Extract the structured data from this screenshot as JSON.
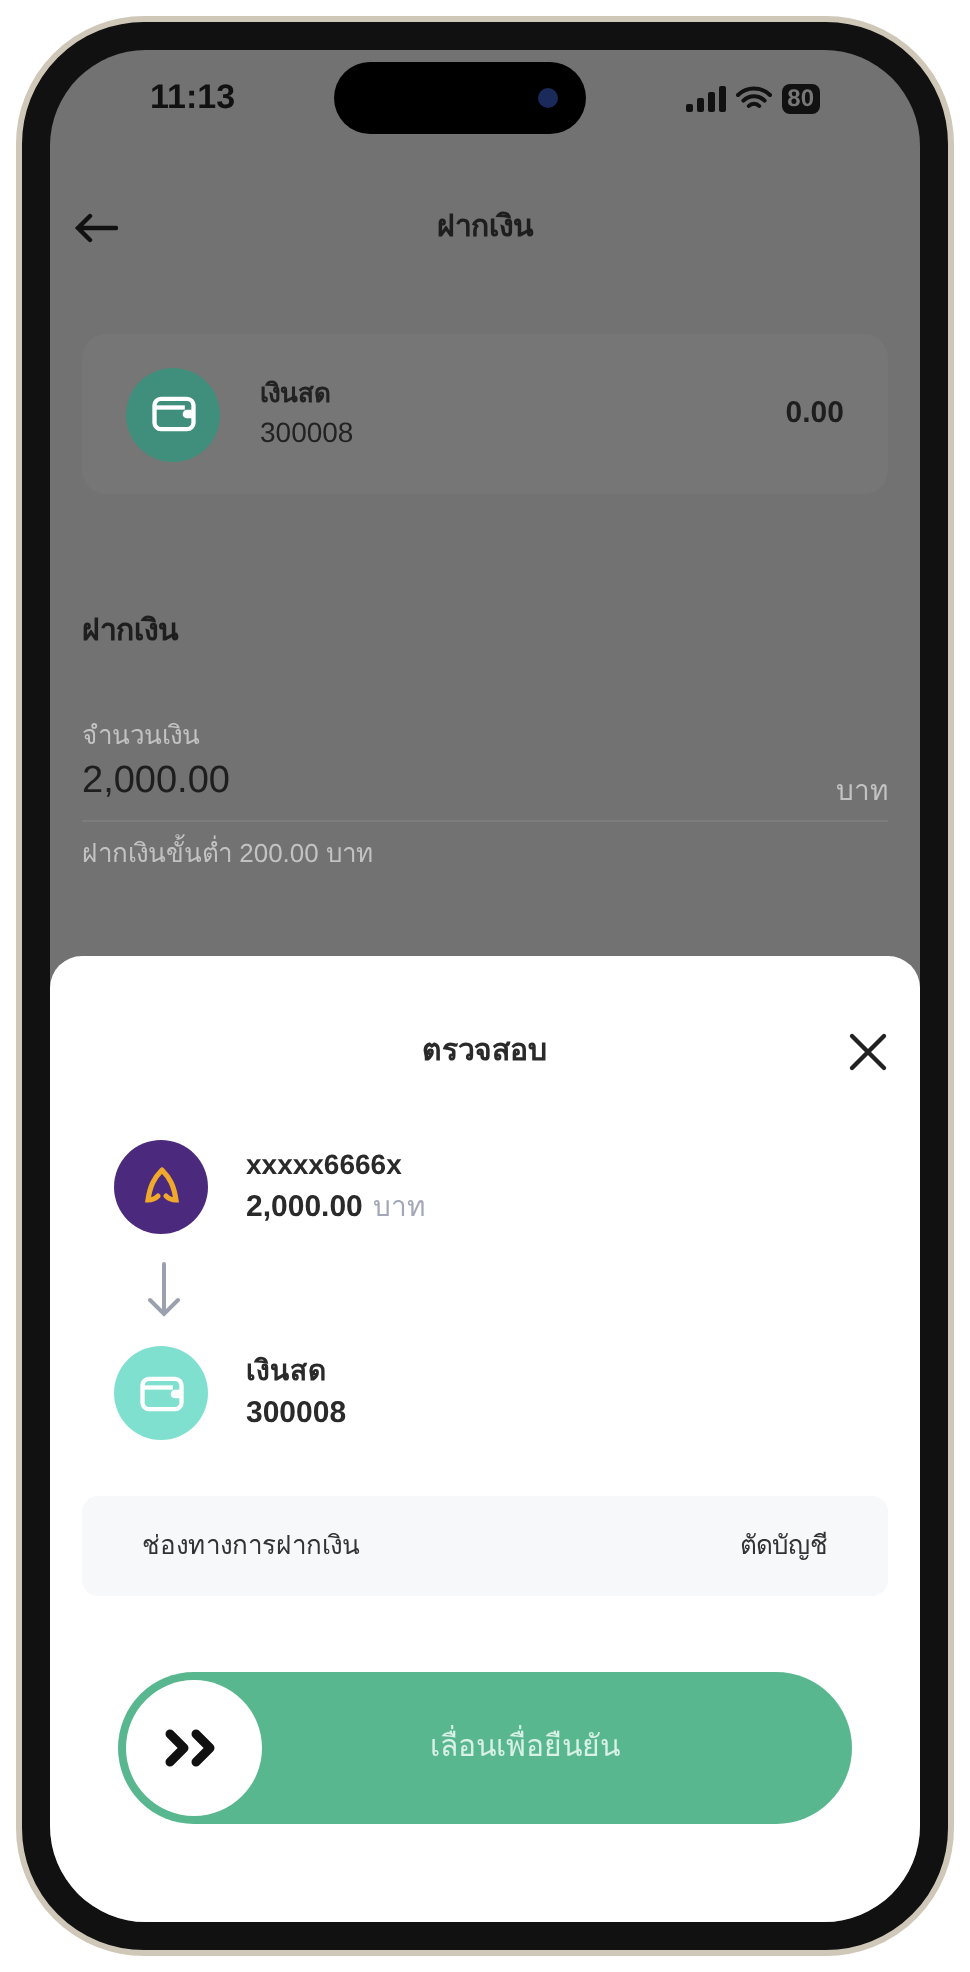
{
  "status_bar": {
    "time": "11:13",
    "battery": "80"
  },
  "header": {
    "title": "ฝากเงิน"
  },
  "account_card": {
    "name": "เงินสด",
    "number": "300008",
    "balance": "0.00"
  },
  "deposit": {
    "title": "ฝากเงิน",
    "amount_label": "จำนวนเงิน",
    "amount": "2,000.00",
    "unit": "บาท",
    "hint": "ฝากเงินขั้นต่ำ 200.00 บาท"
  },
  "sheet": {
    "title": "ตรวจสอบ",
    "from": {
      "account": "xxxxx6666x",
      "amount": "2,000.00",
      "unit": "บาท"
    },
    "to": {
      "name": "เงินสด",
      "number": "300008"
    },
    "channel": {
      "label": "ช่องทางการฝากเงิน",
      "value": "ตัดบัญชี"
    },
    "slider": {
      "label": "เลื่อนเพื่อยืนยัน",
      "level": 0
    }
  }
}
